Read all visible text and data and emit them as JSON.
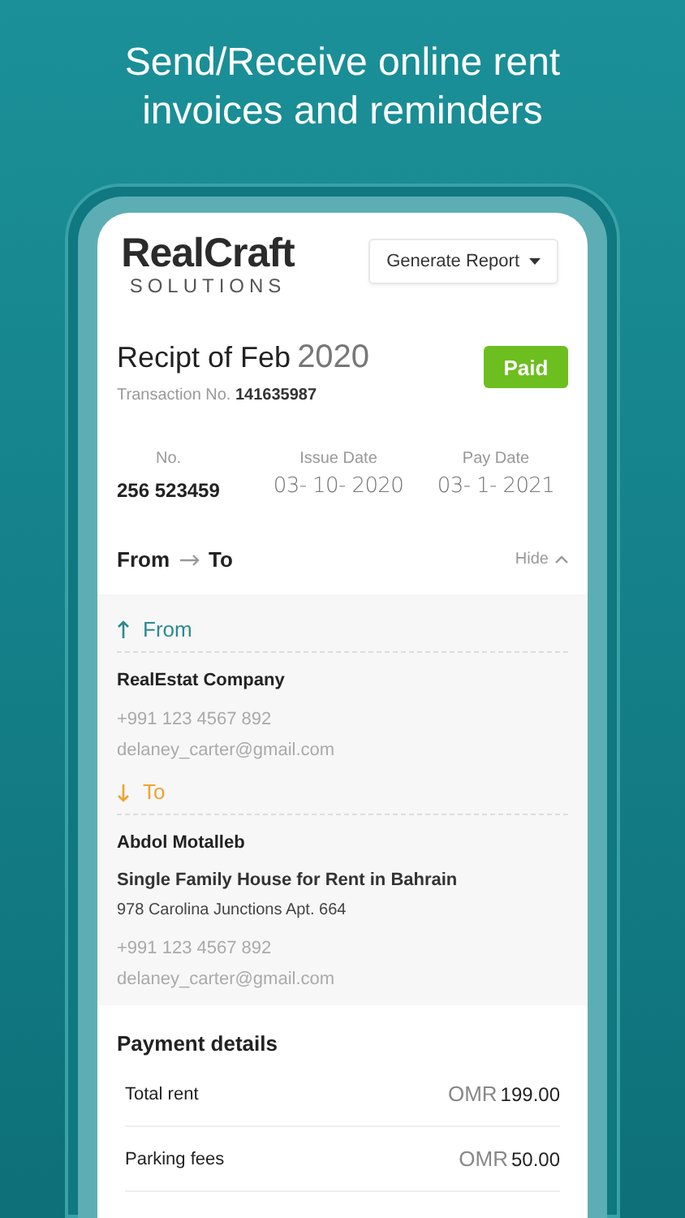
{
  "headline": "Send/Receive online rent invoices and reminders",
  "logo": {
    "name": "RealCraft",
    "tagline": "SOLUTIONS"
  },
  "report_button": {
    "label": "Generate Report"
  },
  "receipt": {
    "title": "Recipt of Feb",
    "year": "2020",
    "transaction": "Transaction No. **141635987**",
    "status": "Paid"
  },
  "details": [
    {
      "label": "No.",
      "value": "256 523459",
      "kind": "number"
    },
    {
      "label": "Issue Date",
      "value": "03- 10- 2020",
      "kind": "date"
    },
    {
      "label": "Pay Date",
      "value": "03- 1- 2021",
      "kind": "date"
    }
  ],
  "parties_header": {
    "from": "From",
    "to": "To",
    "toggle": "Hide",
    "expanded": true
  },
  "parties": [
    {
      "kind": "from",
      "heading": "From",
      "color": "#2a8a90",
      "name": "RealEstat Company",
      "phone": "+991 123 4567 892",
      "email": "delaney_carter@gmail.com"
    },
    {
      "kind": "to",
      "heading": "To",
      "color": "#f0a32e",
      "name": "Abdol Motalleb",
      "lines": [
        {
          "text": "Single Family House for Rent in Bahrain",
          "kind": "strong"
        },
        {
          "text": "978 Carolina Junctions Apt. 664",
          "kind": "plain"
        }
      ],
      "phone": "+991 123 4567 892",
      "email": "delaney_carter@gmail.com"
    }
  ],
  "payment": {
    "title": "Payment details",
    "rows": [
      {
        "label": "Total rent",
        "currency": "OMR",
        "amount": "199.00"
      },
      {
        "label": "Parking fees",
        "currency": "OMR",
        "amount": "50.00"
      }
    ]
  }
}
